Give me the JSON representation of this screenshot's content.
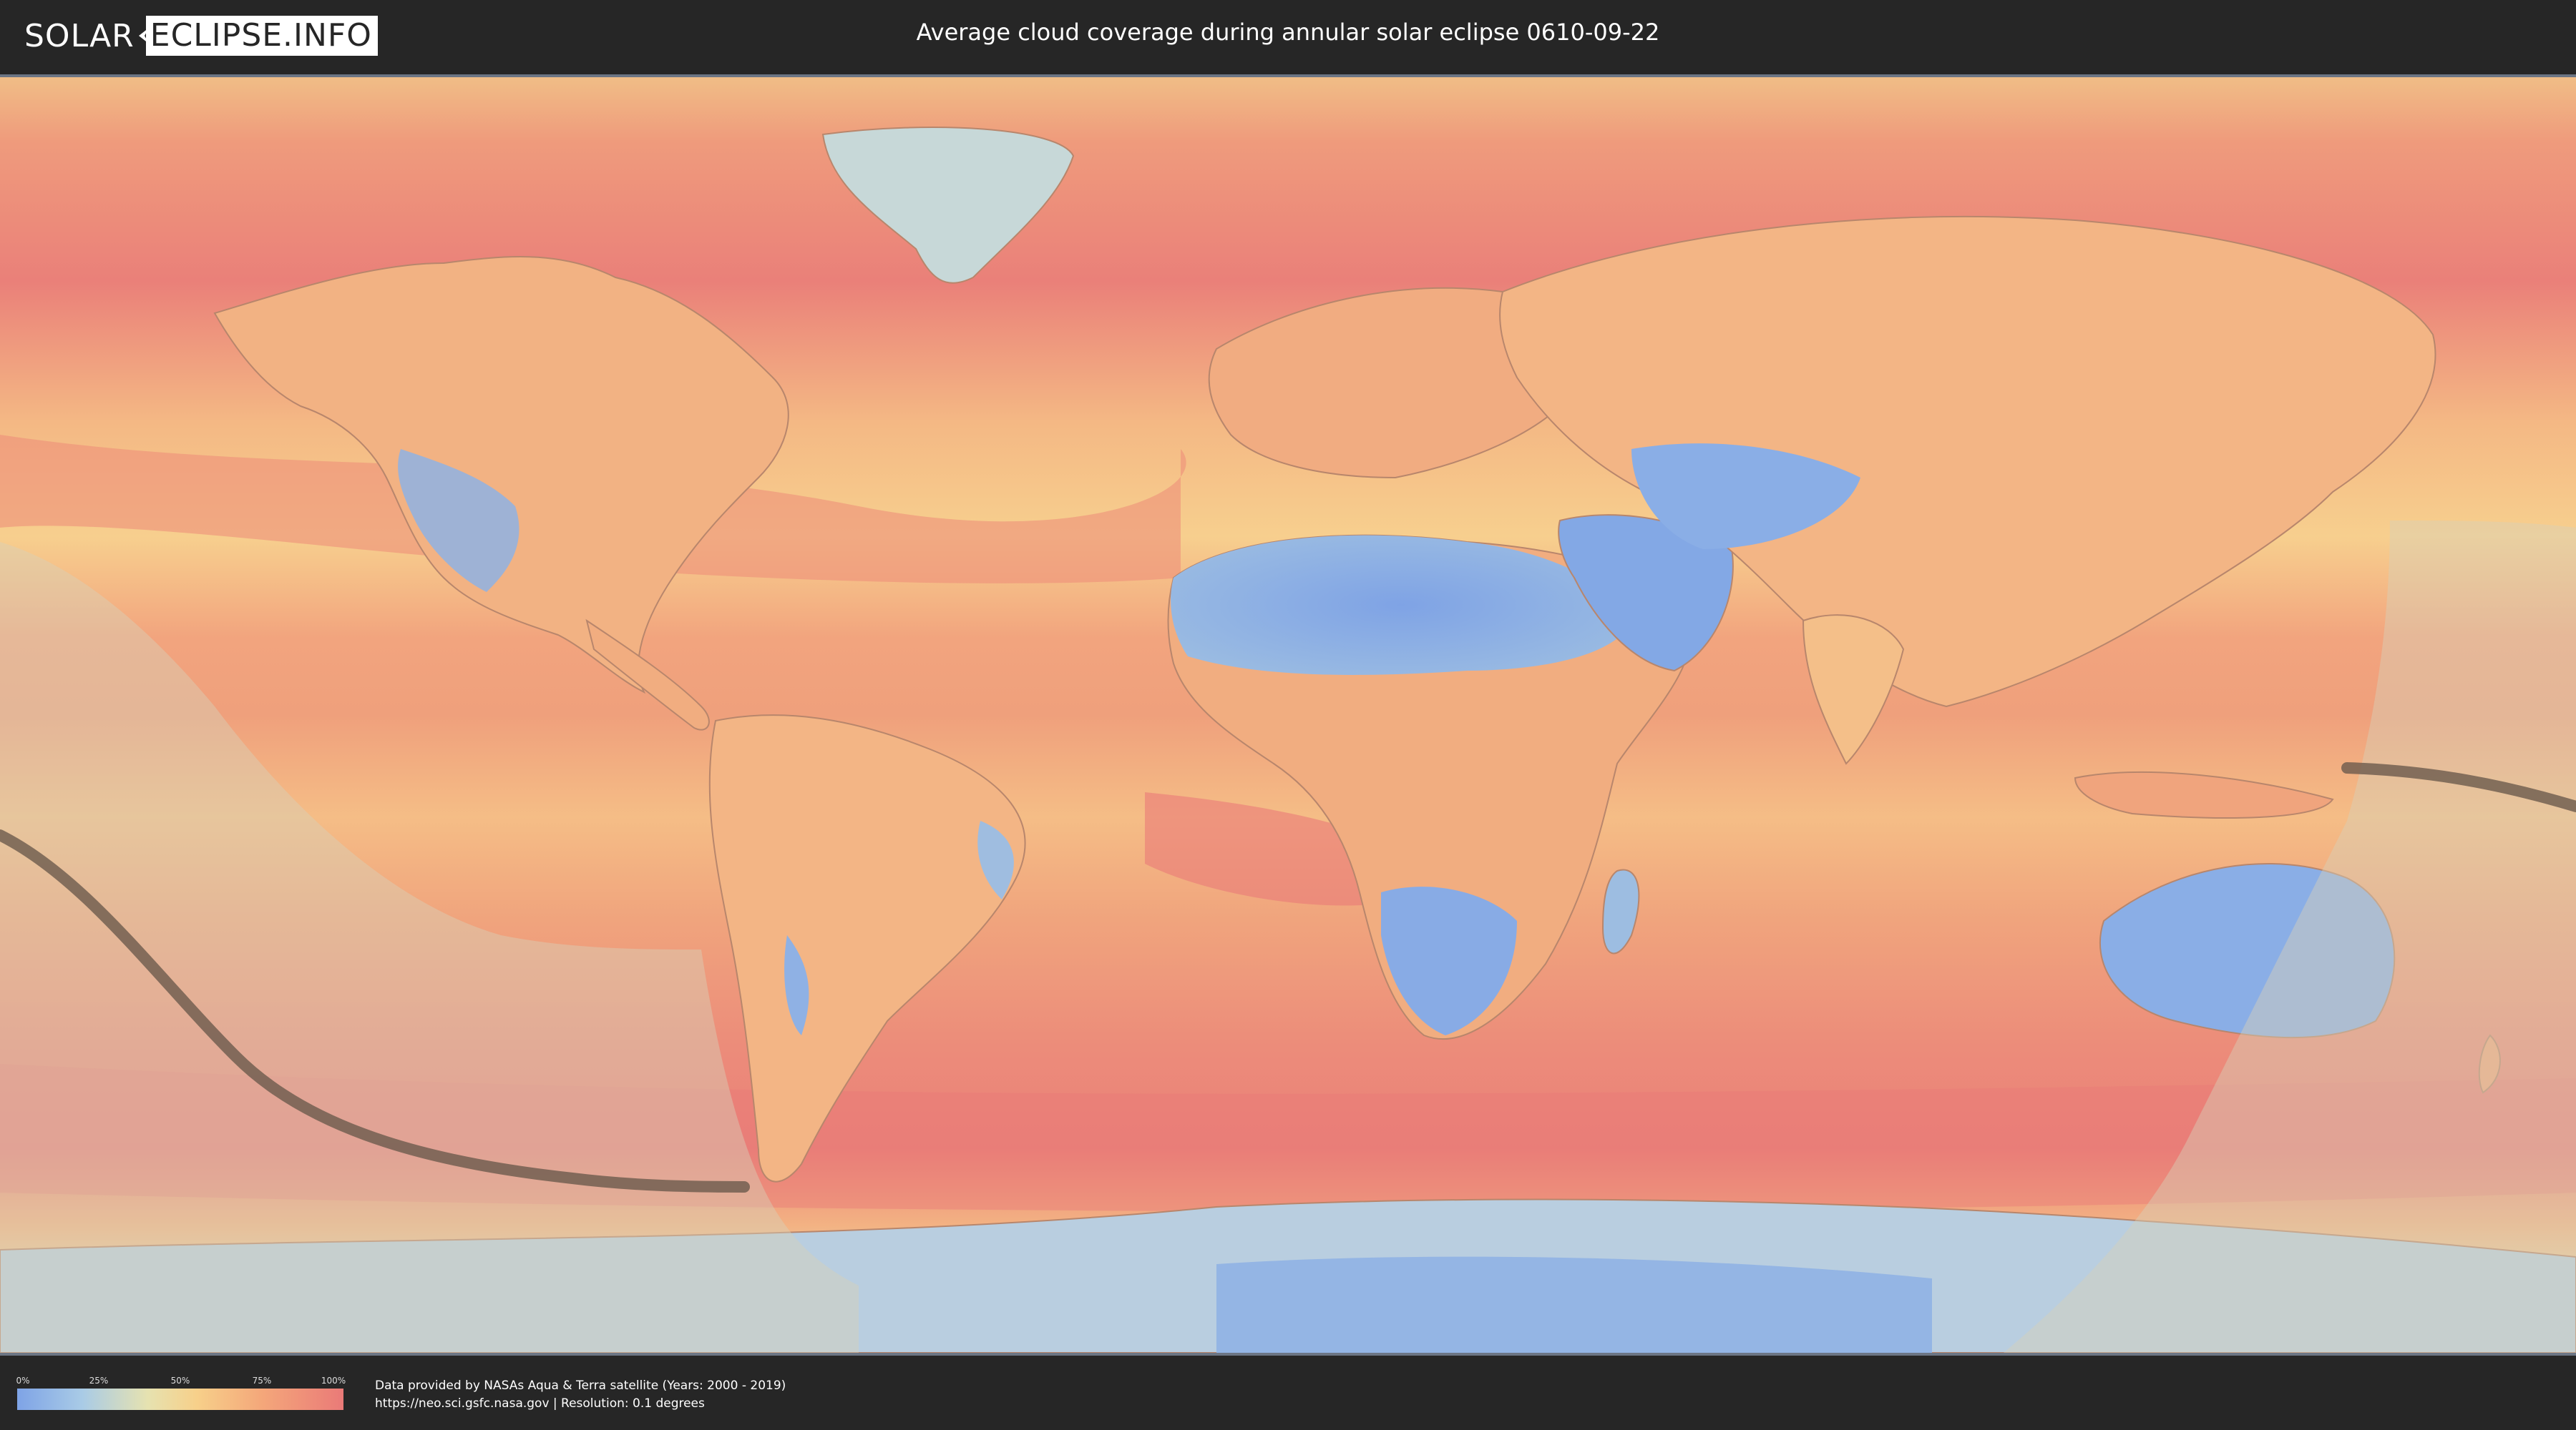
{
  "header": {
    "logo_left": "SOLAR",
    "logo_right": "ECLIPSE.INFO",
    "title": "Average cloud coverage during annular solar eclipse 0610-09-22"
  },
  "legend": {
    "ticks": [
      "0%",
      "25%",
      "50%",
      "75%",
      "100%"
    ],
    "colors": {
      "low": "#7ea3e6",
      "mid_low": "#a9cbe6",
      "mid": "#e6e2b0",
      "mid_high": "#f7d08a",
      "high": "#ea7a78"
    }
  },
  "credits": {
    "line1": "Data provided by NASAs Aqua & Terra satellite (Years: 2000 - 2019)",
    "line2": "https://neo.sci.gsfc.nasa.gov | Resolution: 0.1 degrees"
  },
  "map": {
    "ocean_color": "#f2a57c",
    "clear_sky_color": "#8aaee6",
    "eclipse_path_color": "#6b5a4c",
    "visibility_zone_color": "#d8d0b8"
  }
}
